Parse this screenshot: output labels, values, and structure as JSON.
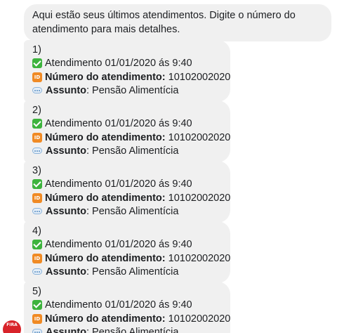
{
  "intro": "Aqui estão seus últimos atendimentos. Digite o número do atendimento para mais detalhes.",
  "avatar_label": "FIRA",
  "cards": [
    {
      "index": "1)",
      "date_line": "Atendimento 01/01/2020 ás 9:40",
      "number_label": "Número do atendimento:",
      "number_value": "10102002020",
      "subject_label": "Assunto",
      "subject_value": ": Pensão Alimentícia"
    },
    {
      "index": "2)",
      "date_line": "Atendimento 01/01/2020 ás 9:40",
      "number_label": "Número do atendimento:",
      "number_value": "10102002020",
      "subject_label": "Assunto",
      "subject_value": ": Pensão Alimentícia"
    },
    {
      "index": "3)",
      "date_line": "Atendimento 01/01/2020 ás 9:40",
      "number_label": "Número do atendimento:",
      "number_value": "10102002020",
      "subject_label": "Assunto",
      "subject_value": ": Pensão Alimentícia"
    },
    {
      "index": "4)",
      "date_line": "Atendimento 01/01/2020 ás 9:40",
      "number_label": "Número do atendimento:",
      "number_value": "10102002020",
      "subject_label": "Assunto",
      "subject_value": ": Pensão Alimentícia"
    },
    {
      "index": "5)",
      "date_line": "Atendimento 01/01/2020 ás 9:40",
      "number_label": "Número do atendimento:",
      "number_value": "10102002020",
      "subject_label": "Assunto",
      "subject_value": ": Pensão Alimentícia"
    }
  ]
}
